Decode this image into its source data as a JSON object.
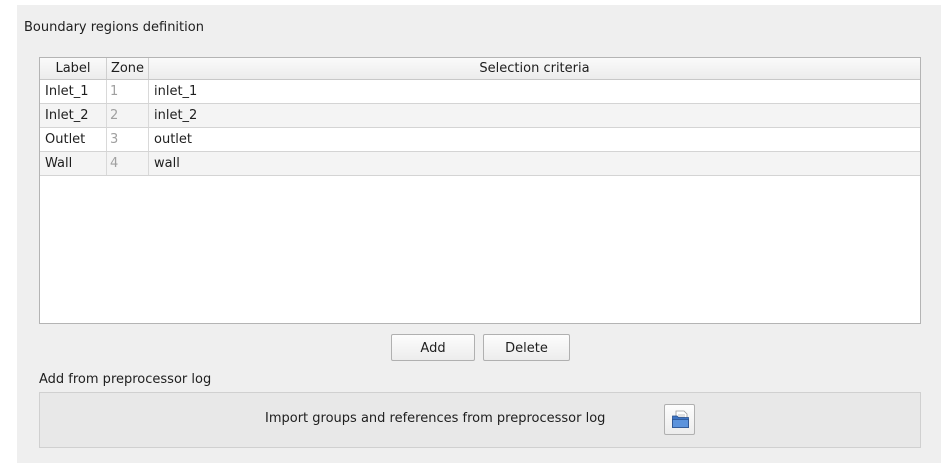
{
  "section": {
    "title": "Boundary regions definition"
  },
  "table": {
    "headers": {
      "label": "Label",
      "zone": "Zone",
      "criteria": "Selection criteria"
    },
    "rows": [
      {
        "label": "Inlet_1",
        "zone": "1",
        "criteria": "inlet_1"
      },
      {
        "label": "Inlet_2",
        "zone": "2",
        "criteria": "inlet_2"
      },
      {
        "label": "Outlet",
        "zone": "3",
        "criteria": "outlet"
      },
      {
        "label": "Wall",
        "zone": "4",
        "criteria": "wall"
      }
    ]
  },
  "buttons": {
    "add": "Add",
    "delete": "Delete"
  },
  "preprocessor": {
    "title": "Add from preprocessor log",
    "import_label": "Import groups and references from preprocessor log",
    "icon": "folder-open-icon"
  }
}
